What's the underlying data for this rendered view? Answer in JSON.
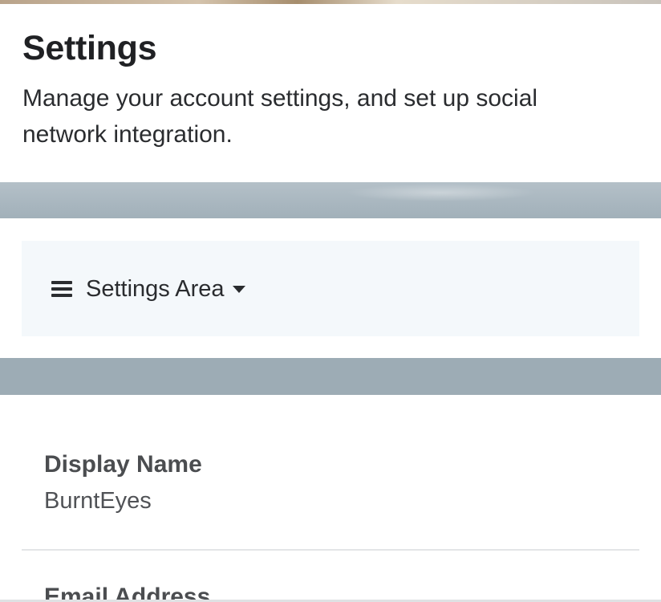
{
  "header": {
    "title": "Settings",
    "subtitle": "Manage your account settings, and set up social network integration."
  },
  "nav": {
    "dropdown_label": "Settings Area",
    "menu_icon": "hamburger-icon",
    "caret_icon": "caret-down-icon"
  },
  "fields": [
    {
      "label": "Display Name",
      "value": "BurntEyes"
    },
    {
      "label": "Email Address",
      "value": ""
    }
  ],
  "colors": {
    "background_band": "#9dacb5",
    "dropdown_background": "#f4f8fb",
    "title_text": "#202124",
    "field_label_text": "#4b4d50"
  }
}
